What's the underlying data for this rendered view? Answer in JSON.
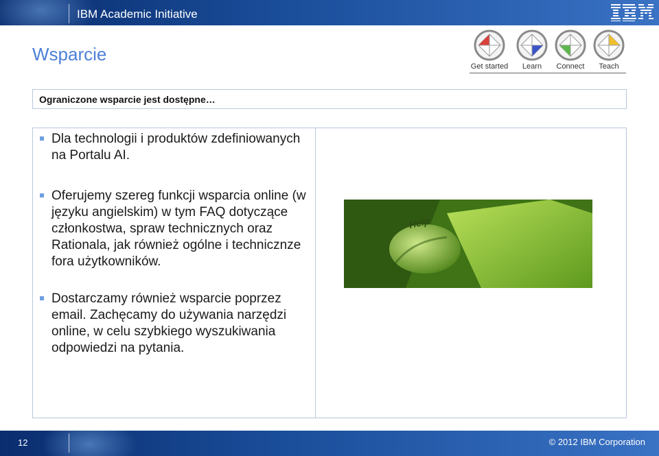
{
  "header": {
    "brand": "IBM Academic Initiative",
    "logo_text": "IBM"
  },
  "title": "Wsparcie",
  "steps": [
    {
      "label": "Get started",
      "color": "#d9413a"
    },
    {
      "label": "Learn",
      "color": "#3b54c8"
    },
    {
      "label": "Connect",
      "color": "#5cb84a"
    },
    {
      "label": "Teach",
      "color": "#f0c030"
    }
  ],
  "notice": "Ograniczone wsparcie jest dostępne…",
  "bullets": [
    "Dla technologii i produktów zdefiniowanych na Portalu AI.",
    "Oferujemy szereg funkcji wsparcia online (w języku angielskim) w tym FAQ dotyczące członkostwa, spraw technicznych oraz Rationala, jak również ogólne i technicznze fora użytkowników.",
    "Dostarczamy również wsparcie poprzez email. Zachęcamy do używania narzędzi online, w celu szybkiego wyszukiwania odpowiedzi na pytania."
  ],
  "photo": {
    "key_text": "Help"
  },
  "footer": {
    "page_number": "12",
    "copyright": "© 2012 IBM Corporation"
  }
}
